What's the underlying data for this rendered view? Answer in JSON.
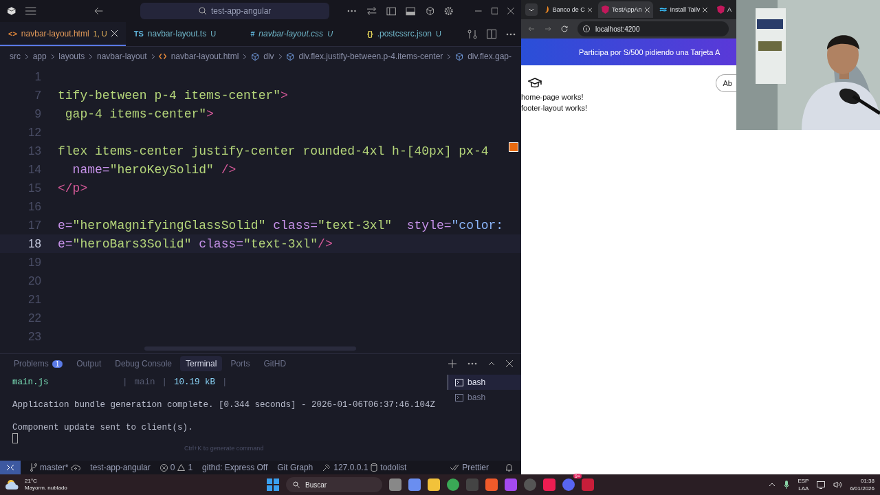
{
  "editor": {
    "search": "test-app-angular",
    "tabs": [
      {
        "icon": "<>",
        "label": "navbar-layout.html",
        "suffix": "1, U",
        "kind": "html",
        "selected": true
      },
      {
        "icon": "TS",
        "label": "navbar-layout.ts",
        "suffix": "U",
        "kind": "ts",
        "selected": false
      },
      {
        "icon": "#",
        "label": "navbar-layout.css",
        "suffix": "U",
        "kind": "css",
        "selected": false
      },
      {
        "icon": "{}",
        "label": ".postcssrc.json",
        "suffix": "U",
        "kind": "json",
        "selected": false
      }
    ],
    "breadcrumbs": [
      {
        "label": "src",
        "kind": "folder"
      },
      {
        "label": "app",
        "kind": "folder"
      },
      {
        "label": "layouts",
        "kind": "folder"
      },
      {
        "label": "navbar-layout",
        "kind": "folder"
      },
      {
        "label": "navbar-layout.html",
        "kind": "file"
      },
      {
        "label": "div",
        "kind": "element"
      },
      {
        "label": "div.flex.justify-between.p-4.items-center",
        "kind": "element"
      },
      {
        "label": "div.flex.gap-",
        "kind": "element"
      }
    ],
    "lines": [
      {
        "number": "1",
        "current": false
      },
      {
        "number": "7",
        "current": false,
        "segments": [
          {
            "kind": "string",
            "text": "tify-between p-4 items-center\""
          },
          {
            "kind": "tag",
            "text": ">"
          }
        ]
      },
      {
        "number": "9",
        "current": false,
        "segments": [
          {
            "kind": "string",
            "text": " gap-4 items-center\""
          },
          {
            "kind": "tag",
            "text": ">"
          }
        ]
      },
      {
        "number": "12",
        "current": false
      },
      {
        "number": "13",
        "current": false,
        "segments": [
          {
            "kind": "string",
            "text": "flex items-center justify-center rounded-4xl h-[40px] px-4"
          }
        ]
      },
      {
        "number": "14",
        "current": false,
        "segments": [
          {
            "kind": "attr",
            "text": "  name="
          },
          {
            "kind": "string",
            "text": "\"heroKeySolid\""
          },
          {
            "kind": "tag",
            "text": " />"
          }
        ]
      },
      {
        "number": "15",
        "current": false,
        "segments": [
          {
            "kind": "tag",
            "text": "</p>"
          }
        ]
      },
      {
        "number": "16",
        "current": false
      },
      {
        "number": "17",
        "current": false,
        "segments": [
          {
            "kind": "attr",
            "text": "e="
          },
          {
            "kind": "string",
            "text": "\"heroMagnifyingGlassSolid\""
          },
          {
            "kind": "attr",
            "text": " class="
          },
          {
            "kind": "string",
            "text": "\"text-3xl\""
          },
          {
            "kind": "attr",
            "text": "  style="
          },
          {
            "kind": "value",
            "text": "\"color:"
          }
        ]
      },
      {
        "number": "18",
        "current": true,
        "segments": [
          {
            "kind": "attr",
            "text": "e="
          },
          {
            "kind": "string",
            "text": "\"heroBars3Solid\""
          },
          {
            "kind": "attr",
            "text": " class="
          },
          {
            "kind": "string",
            "text": "\"text-3xl\""
          },
          {
            "kind": "tag",
            "text": "/>"
          }
        ]
      },
      {
        "number": "19",
        "current": false
      },
      {
        "number": "20",
        "current": false
      },
      {
        "number": "21",
        "current": false
      },
      {
        "number": "22",
        "current": false
      },
      {
        "number": "23",
        "current": false
      }
    ],
    "panel": {
      "tabs": [
        {
          "label": "Problems",
          "count": "1",
          "selected": false
        },
        {
          "label": "Output",
          "selected": false
        },
        {
          "label": "Debug Console",
          "selected": false
        },
        {
          "label": "Terminal",
          "selected": true
        },
        {
          "label": "Ports",
          "selected": false
        },
        {
          "label": "GitHD",
          "selected": false
        }
      ],
      "bundle": {
        "file": "main.js",
        "separator_1": "|",
        "name": "main",
        "separator_2": "|",
        "size": "10.19 kB",
        "separator_3": "|"
      },
      "output": [
        "Application bundle generation complete. [0.344 seconds] - 2026-01-06T06:37:46.104Z",
        "Component update sent to client(s)."
      ],
      "hint": "Ctrl+K to generate command",
      "terminals": [
        {
          "label": "bash",
          "selected": true
        },
        {
          "label": "bash",
          "selected": false
        }
      ]
    },
    "status_bar": {
      "branch": "master*",
      "project": "test-app-angular",
      "errors": "0",
      "warnings": "1",
      "githd": "githd: Express Off",
      "git_graph": "Git Graph",
      "host": "127.0.0.1",
      "database": "todolist",
      "formatter": "Prettier"
    }
  },
  "browser": {
    "tabs": [
      {
        "label": "Banco de C",
        "kind": "flame",
        "selected": false
      },
      {
        "label": "TestAppAn",
        "kind": "angular",
        "selected": true
      },
      {
        "label": "Install Tailv",
        "kind": "wave",
        "selected": false
      },
      {
        "label": "A",
        "kind": "angular",
        "selected": false
      }
    ],
    "url": "localhost:4200",
    "banner": "Participa por S/500 pidiendo una Tarjeta A",
    "nav_button": "Ab",
    "texts": [
      "home-page works!",
      "footer-layout works!"
    ],
    "webcam": {
      "kind": "picture"
    }
  },
  "taskbar": {
    "temperature": "21°C",
    "weather": "Mayorm. nublado",
    "search": "Buscar",
    "discord_badge": "9+",
    "language": "ESP",
    "layout": "LAA",
    "time": "01:38",
    "date": "6/01/2026"
  }
}
